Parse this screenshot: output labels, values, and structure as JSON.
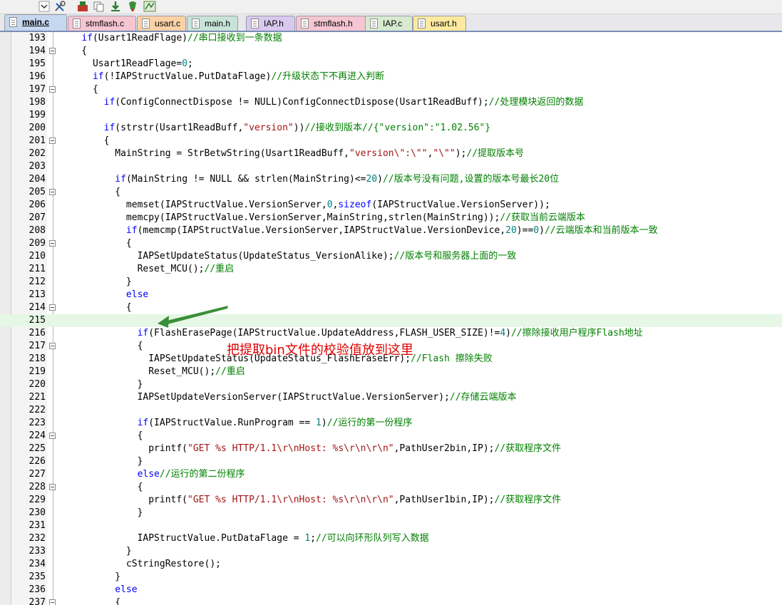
{
  "tabs": [
    {
      "label": "main.c",
      "color": "#c6d7f0",
      "active": true
    },
    {
      "label": "stmflash.c",
      "color": "#f5c6d2",
      "active": false
    },
    {
      "label": "usart.c",
      "color": "#fbd2a6",
      "active": false
    },
    {
      "label": "main.h",
      "color": "#c8e4d8",
      "active": false
    },
    {
      "label": "IAP.h",
      "color": "#d9c9ef",
      "active": false
    },
    {
      "label": "stmflash.h",
      "color": "#f5c6d2",
      "active": false
    },
    {
      "label": "IAP.c",
      "color": "#d8ebd1",
      "active": false
    },
    {
      "label": "usart.h",
      "color": "#fdeaa0",
      "active": false
    }
  ],
  "code_lines": [
    {
      "n": "193",
      "fold": false,
      "tokens": [
        [
          "    ",
          ""
        ],
        [
          "if",
          "kw"
        ],
        [
          "(Usart1ReadFlage)",
          ""
        ],
        [
          "//串口接收到一条数据",
          "cm"
        ]
      ]
    },
    {
      "n": "194",
      "fold": true,
      "tokens": [
        [
          "    {",
          ""
        ]
      ]
    },
    {
      "n": "195",
      "fold": false,
      "tokens": [
        [
          "      Usart1ReadFlage=",
          ""
        ],
        [
          "0",
          "nm"
        ],
        [
          ";",
          ""
        ]
      ]
    },
    {
      "n": "196",
      "fold": false,
      "tokens": [
        [
          "      ",
          ""
        ],
        [
          "if",
          "kw"
        ],
        [
          "(!IAPStructValue.PutDataFlage)",
          ""
        ],
        [
          "//升级状态下不再进入判断",
          "cm"
        ]
      ]
    },
    {
      "n": "197",
      "fold": true,
      "tokens": [
        [
          "      {",
          ""
        ]
      ]
    },
    {
      "n": "198",
      "fold": false,
      "tokens": [
        [
          "        ",
          ""
        ],
        [
          "if",
          "kw"
        ],
        [
          "(ConfigConnectDispose != NULL)ConfigConnectDispose(Usart1ReadBuff);",
          ""
        ],
        [
          "//处理模块返回的数据",
          "cm"
        ]
      ]
    },
    {
      "n": "199",
      "fold": false,
      "tokens": [
        [
          "",
          ""
        ]
      ]
    },
    {
      "n": "200",
      "fold": false,
      "tokens": [
        [
          "        ",
          ""
        ],
        [
          "if",
          "kw"
        ],
        [
          "(strstr(Usart1ReadBuff,",
          ""
        ],
        [
          "\"version\"",
          "st"
        ],
        [
          "))",
          ""
        ],
        [
          "//接收到版本//{\"version\":\"1.02.56\"}",
          "cm"
        ]
      ]
    },
    {
      "n": "201",
      "fold": true,
      "tokens": [
        [
          "        {",
          ""
        ]
      ]
    },
    {
      "n": "202",
      "fold": false,
      "tokens": [
        [
          "          MainString = StrBetwString(Usart1ReadBuff,",
          ""
        ],
        [
          "\"version\\\":\\\"\"",
          "st"
        ],
        [
          ",",
          ""
        ],
        [
          "\"\\\"\"",
          "st"
        ],
        [
          ");",
          ""
        ],
        [
          "//提取版本号",
          "cm"
        ]
      ]
    },
    {
      "n": "203",
      "fold": false,
      "tokens": [
        [
          "",
          ""
        ]
      ]
    },
    {
      "n": "204",
      "fold": false,
      "tokens": [
        [
          "          ",
          ""
        ],
        [
          "if",
          "kw"
        ],
        [
          "(MainString != NULL && strlen(MainString)<=",
          ""
        ],
        [
          "20",
          "nm"
        ],
        [
          ")",
          ""
        ],
        [
          "//版本号没有问题,设置的版本号最长20位",
          "cm"
        ]
      ]
    },
    {
      "n": "205",
      "fold": true,
      "tokens": [
        [
          "          {",
          ""
        ]
      ]
    },
    {
      "n": "206",
      "fold": false,
      "tokens": [
        [
          "            memset(IAPStructValue.VersionServer,",
          ""
        ],
        [
          "0",
          "nm"
        ],
        [
          ",",
          ""
        ],
        [
          "sizeof",
          "kw"
        ],
        [
          "(IAPStructValue.VersionServer));",
          ""
        ]
      ]
    },
    {
      "n": "207",
      "fold": false,
      "tokens": [
        [
          "            memcpy(IAPStructValue.VersionServer,MainString,strlen(MainString));",
          ""
        ],
        [
          "//获取当前云端版本",
          "cm"
        ]
      ]
    },
    {
      "n": "208",
      "fold": false,
      "tokens": [
        [
          "            ",
          ""
        ],
        [
          "if",
          "kw"
        ],
        [
          "(memcmp(IAPStructValue.VersionServer,IAPStructValue.VersionDevice,",
          ""
        ],
        [
          "20",
          "nm"
        ],
        [
          ")==",
          ""
        ],
        [
          "0",
          "nm"
        ],
        [
          ")",
          ""
        ],
        [
          "//云端版本和当前版本一致",
          "cm"
        ]
      ]
    },
    {
      "n": "209",
      "fold": true,
      "tokens": [
        [
          "            {",
          ""
        ]
      ]
    },
    {
      "n": "210",
      "fold": false,
      "tokens": [
        [
          "              IAPSetUpdateStatus(UpdateStatus_VersionAlike);",
          ""
        ],
        [
          "//版本号和服务器上面的一致",
          "cm"
        ]
      ]
    },
    {
      "n": "211",
      "fold": false,
      "tokens": [
        [
          "              Reset_MCU();",
          ""
        ],
        [
          "//重启",
          "cm"
        ]
      ]
    },
    {
      "n": "212",
      "fold": false,
      "tokens": [
        [
          "            }",
          ""
        ]
      ]
    },
    {
      "n": "213",
      "fold": false,
      "tokens": [
        [
          "            ",
          ""
        ],
        [
          "else",
          "kw"
        ]
      ]
    },
    {
      "n": "214",
      "fold": true,
      "tokens": [
        [
          "            {",
          ""
        ]
      ]
    },
    {
      "n": "215",
      "fold": false,
      "hl": true,
      "tokens": [
        [
          "",
          ""
        ]
      ]
    },
    {
      "n": "216",
      "fold": false,
      "tokens": [
        [
          "              ",
          ""
        ],
        [
          "if",
          "kw"
        ],
        [
          "(FlashErasePage(IAPStructValue.UpdateAddress,FLASH_USER_SIZE)!=",
          ""
        ],
        [
          "4",
          "nm"
        ],
        [
          ")",
          ""
        ],
        [
          "//擦除接收用户程序Flash地址",
          "cm"
        ]
      ]
    },
    {
      "n": "217",
      "fold": true,
      "tokens": [
        [
          "              {",
          ""
        ]
      ]
    },
    {
      "n": "218",
      "fold": false,
      "tokens": [
        [
          "                IAPSetUpdateStatus(UpdateStatus_FlashEraseErr);",
          ""
        ],
        [
          "//Flash 擦除失败",
          "cm"
        ]
      ]
    },
    {
      "n": "219",
      "fold": false,
      "tokens": [
        [
          "                Reset_MCU();",
          ""
        ],
        [
          "//重启",
          "cm"
        ]
      ]
    },
    {
      "n": "220",
      "fold": false,
      "tokens": [
        [
          "              }",
          ""
        ]
      ]
    },
    {
      "n": "221",
      "fold": false,
      "tokens": [
        [
          "              IAPSetUpdateVersionServer(IAPStructValue.VersionServer);",
          ""
        ],
        [
          "//存储云端版本",
          "cm"
        ]
      ]
    },
    {
      "n": "222",
      "fold": false,
      "tokens": [
        [
          "",
          ""
        ]
      ]
    },
    {
      "n": "223",
      "fold": false,
      "tokens": [
        [
          "              ",
          ""
        ],
        [
          "if",
          "kw"
        ],
        [
          "(IAPStructValue.RunProgram == ",
          ""
        ],
        [
          "1",
          "nm"
        ],
        [
          ")",
          ""
        ],
        [
          "//运行的第一份程序",
          "cm"
        ]
      ]
    },
    {
      "n": "224",
      "fold": true,
      "tokens": [
        [
          "              {",
          ""
        ]
      ]
    },
    {
      "n": "225",
      "fold": false,
      "tokens": [
        [
          "                printf(",
          ""
        ],
        [
          "\"GET %s HTTP/1.1\\r\\nHost: %s\\r\\n\\r\\n\"",
          "st"
        ],
        [
          ",PathUser2bin,IP);",
          ""
        ],
        [
          "//获取程序文件",
          "cm"
        ]
      ]
    },
    {
      "n": "226",
      "fold": false,
      "tokens": [
        [
          "              }",
          ""
        ]
      ]
    },
    {
      "n": "227",
      "fold": false,
      "tokens": [
        [
          "              ",
          ""
        ],
        [
          "else",
          "kw"
        ],
        [
          "//运行的第二份程序",
          "cm"
        ]
      ]
    },
    {
      "n": "228",
      "fold": true,
      "tokens": [
        [
          "              {",
          ""
        ]
      ]
    },
    {
      "n": "229",
      "fold": false,
      "tokens": [
        [
          "                printf(",
          ""
        ],
        [
          "\"GET %s HTTP/1.1\\r\\nHost: %s\\r\\n\\r\\n\"",
          "st"
        ],
        [
          ",PathUser1bin,IP);",
          ""
        ],
        [
          "//获取程序文件",
          "cm"
        ]
      ]
    },
    {
      "n": "230",
      "fold": false,
      "tokens": [
        [
          "              }",
          ""
        ]
      ]
    },
    {
      "n": "231",
      "fold": false,
      "tokens": [
        [
          "",
          ""
        ]
      ]
    },
    {
      "n": "232",
      "fold": false,
      "tokens": [
        [
          "              IAPStructValue.PutDataFlage = ",
          ""
        ],
        [
          "1",
          "nm"
        ],
        [
          ";",
          ""
        ],
        [
          "//可以向环形队列写入数据",
          "cm"
        ]
      ]
    },
    {
      "n": "233",
      "fold": false,
      "tokens": [
        [
          "            }",
          ""
        ]
      ]
    },
    {
      "n": "234",
      "fold": false,
      "tokens": [
        [
          "            cStringRestore();",
          ""
        ]
      ]
    },
    {
      "n": "235",
      "fold": false,
      "tokens": [
        [
          "          }",
          ""
        ]
      ]
    },
    {
      "n": "236",
      "fold": false,
      "tokens": [
        [
          "          ",
          ""
        ],
        [
          "else",
          "kw"
        ]
      ]
    },
    {
      "n": "237",
      "fold": true,
      "tokens": [
        [
          "          {",
          ""
        ]
      ]
    }
  ],
  "annotation": {
    "text": "把提取bin文件的校验值放到这里",
    "color": "#e00000"
  },
  "colors": {
    "keyword": "#0000ff",
    "comment": "#008000",
    "string": "#a31515",
    "number": "#008080",
    "highlight": "#e6f7e6"
  }
}
